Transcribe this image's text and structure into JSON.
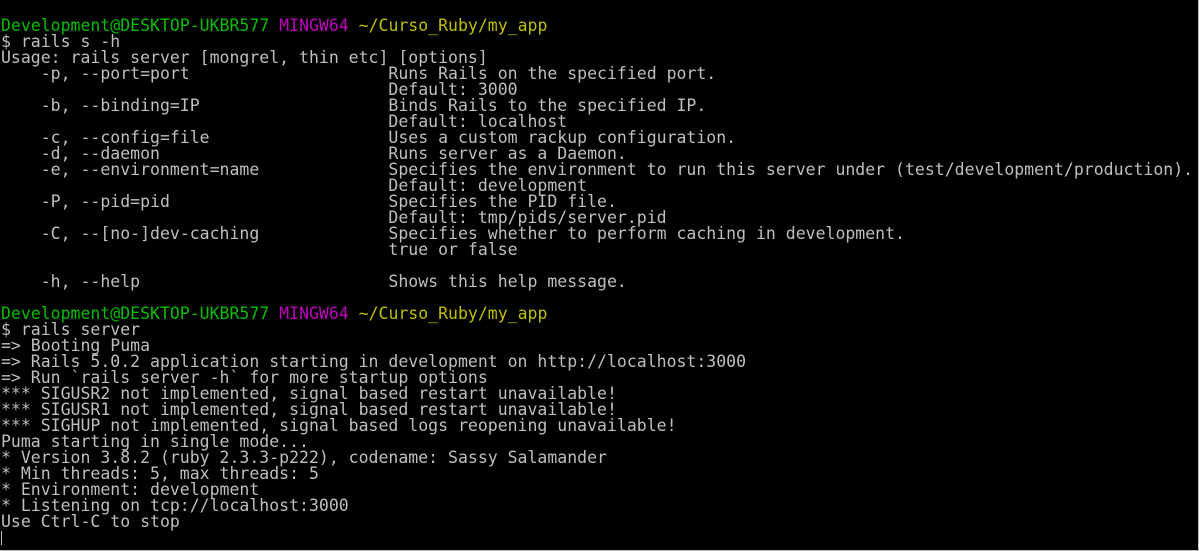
{
  "colors": {
    "background": "#000000",
    "default_text": "#bfbfbf",
    "prompt_user_host": "#00bf00",
    "prompt_system": "#bf00bf",
    "prompt_path": "#bfbf00"
  },
  "lines": [
    {
      "segments": [
        {
          "text": "Development@DESKTOP-UKBR577",
          "color": "green"
        },
        {
          "text": " ",
          "color": "default"
        },
        {
          "text": "MINGW64",
          "color": "magenta"
        },
        {
          "text": " ",
          "color": "default"
        },
        {
          "text": "~/Curso_Ruby/my_app",
          "color": "yellow"
        }
      ]
    },
    {
      "segments": [
        {
          "text": "$ rails s -h",
          "color": "default"
        }
      ]
    },
    {
      "segments": [
        {
          "text": "Usage: rails server [mongrel, thin etc] [options]",
          "color": "default"
        }
      ]
    },
    {
      "segments": [
        {
          "text": "    -p, --port=port                    Runs Rails on the specified port.",
          "color": "default"
        }
      ]
    },
    {
      "segments": [
        {
          "text": "                                       Default: 3000",
          "color": "default"
        }
      ]
    },
    {
      "segments": [
        {
          "text": "    -b, --binding=IP                   Binds Rails to the specified IP.",
          "color": "default"
        }
      ]
    },
    {
      "segments": [
        {
          "text": "                                       Default: localhost",
          "color": "default"
        }
      ]
    },
    {
      "segments": [
        {
          "text": "    -c, --config=file                  Uses a custom rackup configuration.",
          "color": "default"
        }
      ]
    },
    {
      "segments": [
        {
          "text": "    -d, --daemon                       Runs server as a Daemon.",
          "color": "default"
        }
      ]
    },
    {
      "segments": [
        {
          "text": "    -e, --environment=name             Specifies the environment to run this server under (test/development/production).",
          "color": "default"
        }
      ]
    },
    {
      "segments": [
        {
          "text": "                                       Default: development",
          "color": "default"
        }
      ]
    },
    {
      "segments": [
        {
          "text": "    -P, --pid=pid                      Specifies the PID file.",
          "color": "default"
        }
      ]
    },
    {
      "segments": [
        {
          "text": "                                       Default: tmp/pids/server.pid",
          "color": "default"
        }
      ]
    },
    {
      "segments": [
        {
          "text": "    -C, --[no-]dev-caching             Specifies whether to perform caching in development.",
          "color": "default"
        }
      ]
    },
    {
      "segments": [
        {
          "text": "                                       true or false",
          "color": "default"
        }
      ]
    },
    {
      "segments": [
        {
          "text": "",
          "color": "default"
        }
      ]
    },
    {
      "segments": [
        {
          "text": "    -h, --help                         Shows this help message.",
          "color": "default"
        }
      ]
    },
    {
      "segments": [
        {
          "text": "",
          "color": "default"
        }
      ]
    },
    {
      "segments": [
        {
          "text": "Development@DESKTOP-UKBR577",
          "color": "green"
        },
        {
          "text": " ",
          "color": "default"
        },
        {
          "text": "MINGW64",
          "color": "magenta"
        },
        {
          "text": " ",
          "color": "default"
        },
        {
          "text": "~/Curso_Ruby/my_app",
          "color": "yellow"
        }
      ]
    },
    {
      "segments": [
        {
          "text": "$ rails server",
          "color": "default"
        }
      ]
    },
    {
      "segments": [
        {
          "text": "=> Booting Puma",
          "color": "default"
        }
      ]
    },
    {
      "segments": [
        {
          "text": "=> Rails 5.0.2 application starting in development on http://localhost:3000",
          "color": "default"
        }
      ]
    },
    {
      "segments": [
        {
          "text": "=> Run `rails server -h` for more startup options",
          "color": "default"
        }
      ]
    },
    {
      "segments": [
        {
          "text": "*** SIGUSR2 not implemented, signal based restart unavailable!",
          "color": "default"
        }
      ]
    },
    {
      "segments": [
        {
          "text": "*** SIGUSR1 not implemented, signal based restart unavailable!",
          "color": "default"
        }
      ]
    },
    {
      "segments": [
        {
          "text": "*** SIGHUP not implemented, signal based logs reopening unavailable!",
          "color": "default"
        }
      ]
    },
    {
      "segments": [
        {
          "text": "Puma starting in single mode...",
          "color": "default"
        }
      ]
    },
    {
      "segments": [
        {
          "text": "* Version 3.8.2 (ruby 2.3.3-p222), codename: Sassy Salamander",
          "color": "default"
        }
      ]
    },
    {
      "segments": [
        {
          "text": "* Min threads: 5, max threads: 5",
          "color": "default"
        }
      ]
    },
    {
      "segments": [
        {
          "text": "* Environment: development",
          "color": "default"
        }
      ]
    },
    {
      "segments": [
        {
          "text": "* Listening on tcp://localhost:3000",
          "color": "default"
        }
      ]
    },
    {
      "segments": [
        {
          "text": "Use Ctrl-C to stop",
          "color": "default"
        }
      ]
    }
  ]
}
